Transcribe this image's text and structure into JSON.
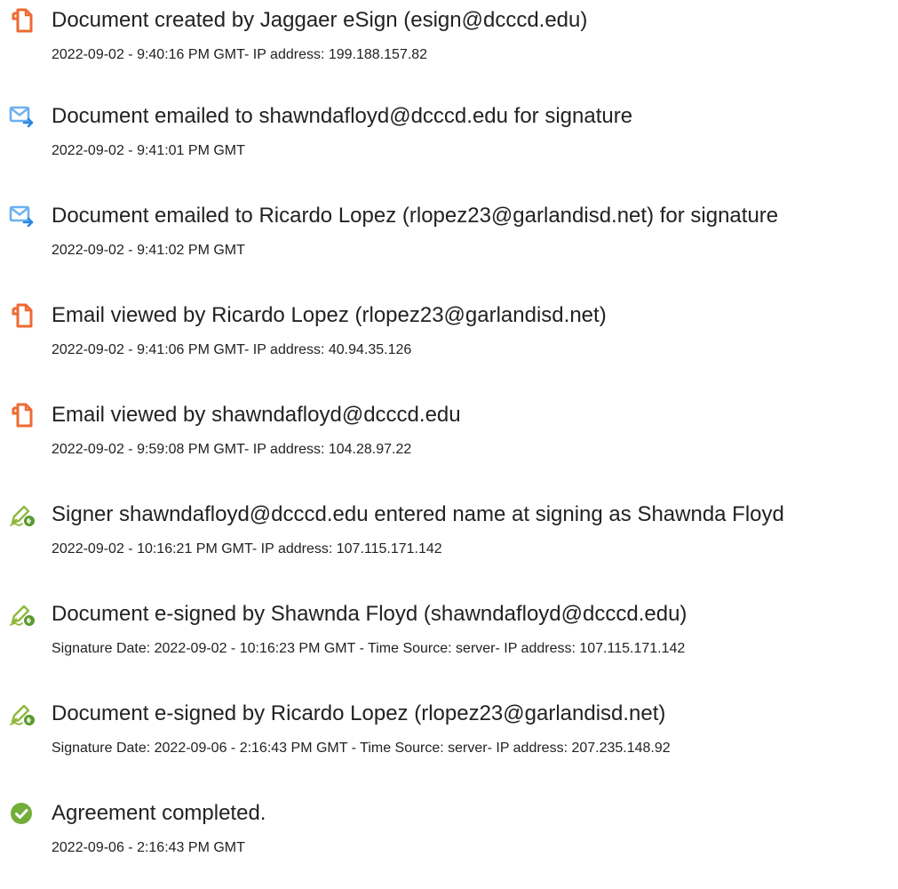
{
  "colors": {
    "document_icon": "#ee6a32",
    "email_icon": "#6db0f0",
    "sign_icon": "#8fb83c",
    "complete_icon": "#73ad3a"
  },
  "events": [
    {
      "icon": "document-icon",
      "title": "Document created by Jaggaer eSign (esign@dcccd.edu)",
      "detail": "2022-09-02 - 9:40:16 PM GMT- IP address: 199.188.157.82"
    },
    {
      "icon": "email-icon",
      "title": "Document emailed to shawndafloyd@dcccd.edu for signature",
      "detail": "2022-09-02 - 9:41:01 PM GMT"
    },
    {
      "icon": "email-icon",
      "title": "Document emailed to Ricardo Lopez (rlopez23@garlandisd.net) for signature",
      "detail": "2022-09-02 - 9:41:02 PM GMT"
    },
    {
      "icon": "document-icon",
      "title": "Email viewed by Ricardo Lopez (rlopez23@garlandisd.net)",
      "detail": "2022-09-02 - 9:41:06 PM GMT- IP address: 40.94.35.126"
    },
    {
      "icon": "document-icon",
      "title": "Email viewed by shawndafloyd@dcccd.edu",
      "detail": "2022-09-02 - 9:59:08 PM GMT- IP address: 104.28.97.22"
    },
    {
      "icon": "sign-icon",
      "title": "Signer shawndafloyd@dcccd.edu entered name at signing as Shawnda Floyd",
      "detail": "2022-09-02 - 10:16:21 PM GMT- IP address: 107.115.171.142"
    },
    {
      "icon": "sign-icon",
      "title": "Document e-signed by Shawnda Floyd (shawndafloyd@dcccd.edu)",
      "detail": "Signature Date: 2022-09-02 - 10:16:23 PM GMT - Time Source: server- IP address: 107.115.171.142"
    },
    {
      "icon": "sign-icon",
      "title": "Document e-signed by Ricardo Lopez (rlopez23@garlandisd.net)",
      "detail": "Signature Date: 2022-09-06 - 2:16:43 PM GMT - Time Source: server- IP address: 207.235.148.92"
    },
    {
      "icon": "check-circle-icon",
      "title": "Agreement completed.",
      "detail": "2022-09-06 - 2:16:43 PM GMT"
    }
  ]
}
